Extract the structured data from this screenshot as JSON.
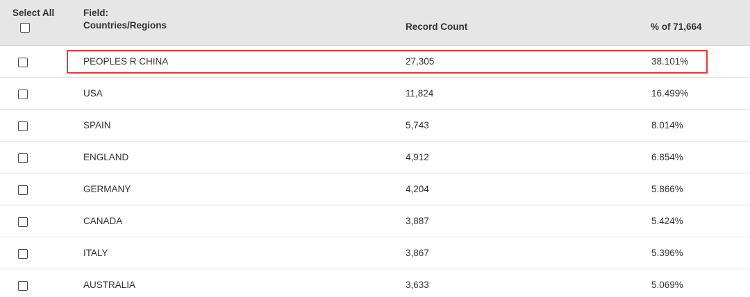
{
  "header": {
    "select_all": "Select All",
    "field_line1": "Field:",
    "field_line2": "Countries/Regions",
    "record_count": "Record Count",
    "percent_of": "% of 71,664"
  },
  "rows": [
    {
      "name": "PEOPLES R CHINA",
      "count": "27,305",
      "pct": "38.101%"
    },
    {
      "name": "USA",
      "count": "11,824",
      "pct": "16.499%"
    },
    {
      "name": "SPAIN",
      "count": "5,743",
      "pct": "8.014%"
    },
    {
      "name": "ENGLAND",
      "count": "4,912",
      "pct": "6.854%"
    },
    {
      "name": "GERMANY",
      "count": "4,204",
      "pct": "5.866%"
    },
    {
      "name": "CANADA",
      "count": "3,887",
      "pct": "5.424%"
    },
    {
      "name": "ITALY",
      "count": "3,867",
      "pct": "5.396%"
    },
    {
      "name": "AUSTRALIA",
      "count": "3,633",
      "pct": "5.069%"
    }
  ],
  "colors": {
    "header_bg": "#e6e6e6",
    "highlight_border": "#e53935",
    "text": "#333333"
  }
}
